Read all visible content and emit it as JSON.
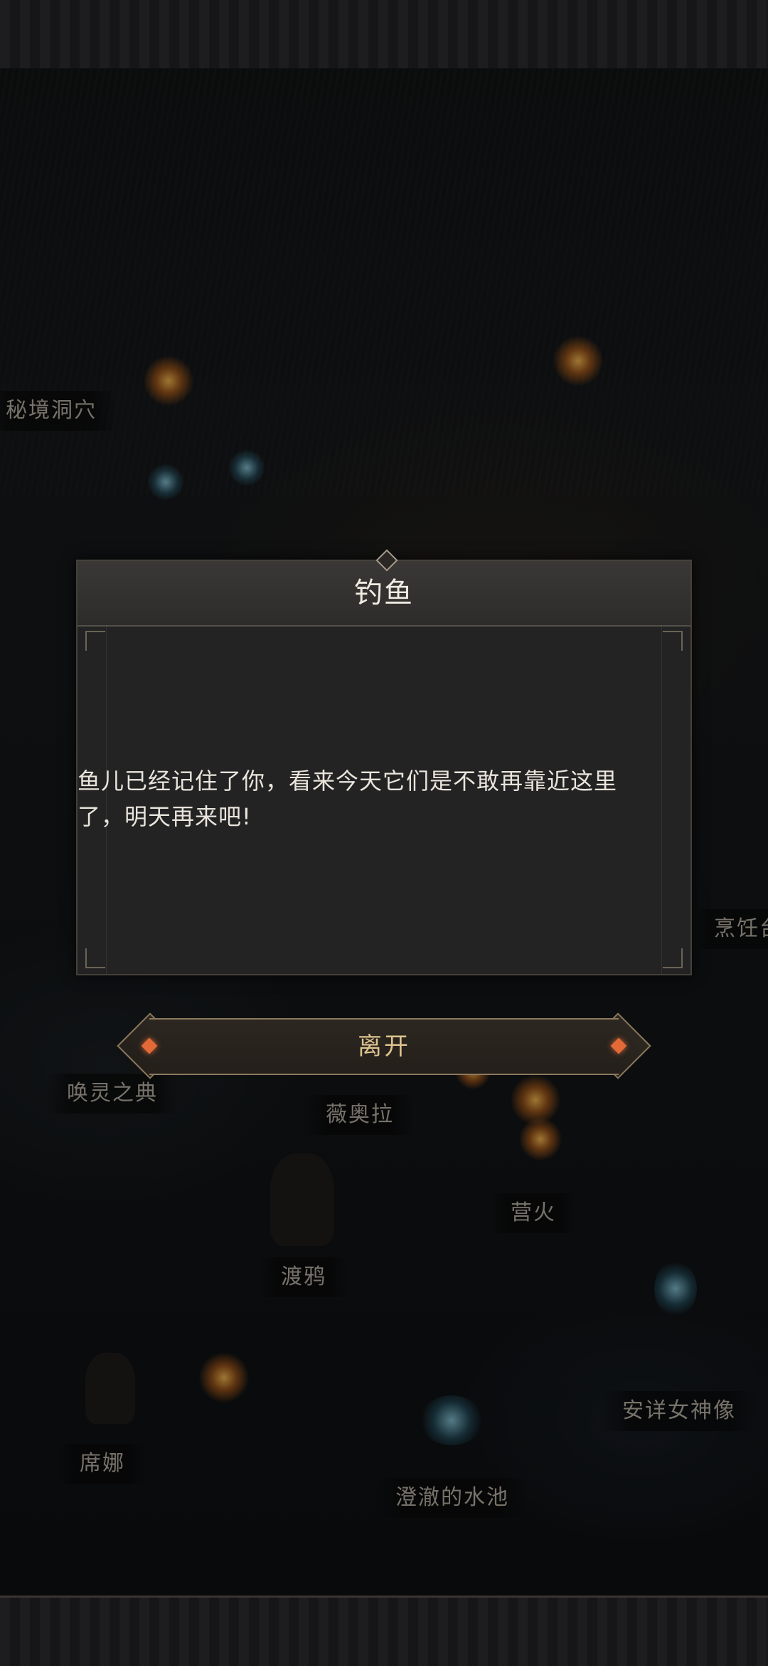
{
  "dialog": {
    "title": "钓鱼",
    "message": "鱼儿已经记住了你，看来今天它们是不敢再靠近这里了，明天再来吧!"
  },
  "leave_button": {
    "label": "离开"
  },
  "map_labels": {
    "secret_cave": "秘境洞穴",
    "cooking": "烹饪台",
    "summon_codex": "唤灵之典",
    "viola": "薇奥拉",
    "campfire": "营火",
    "raven": "渡鸦",
    "goddess_statue": "安详女神像",
    "sina": "席娜",
    "clear_pool": "澄澈的水池"
  }
}
